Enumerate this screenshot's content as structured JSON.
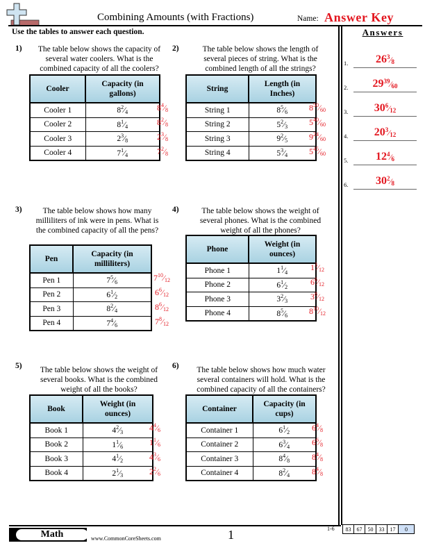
{
  "header": {
    "title": "Combining Amounts (with Fractions)",
    "name_label": "Name:",
    "name_value": "Answer Key",
    "instructions": "Use the tables to answer each question."
  },
  "answers_panel": {
    "title": "Answers",
    "items": [
      {
        "num": "1.",
        "whole": "26",
        "numer": "3",
        "denom": "8"
      },
      {
        "num": "2.",
        "whole": "29",
        "numer": "39",
        "denom": "60"
      },
      {
        "num": "3.",
        "whole": "30",
        "numer": "6",
        "denom": "12"
      },
      {
        "num": "4.",
        "whole": "20",
        "numer": "3",
        "denom": "12"
      },
      {
        "num": "5.",
        "whole": "12",
        "numer": "4",
        "denom": "6"
      },
      {
        "num": "6.",
        "whole": "30",
        "numer": "2",
        "denom": "8"
      }
    ]
  },
  "problems": [
    {
      "num": "1)",
      "text": "The table below shows the capacity of several water coolers. What is the combined capacity of all the coolers?",
      "headers": [
        "Cooler",
        "Capacity (in gallons)"
      ],
      "rows": [
        {
          "label": "Cooler 1",
          "value": {
            "w": "8",
            "n": "2",
            "d": "4"
          },
          "answer": {
            "w": "8",
            "n": "4",
            "d": "8"
          }
        },
        {
          "label": "Cooler 2",
          "value": {
            "w": "8",
            "n": "1",
            "d": "4"
          },
          "answer": {
            "w": "8",
            "n": "2",
            "d": "8"
          }
        },
        {
          "label": "Cooler 3",
          "value": {
            "w": "2",
            "n": "3",
            "d": "8"
          },
          "answer": {
            "w": "2",
            "n": "3",
            "d": "8"
          }
        },
        {
          "label": "Cooler 4",
          "value": {
            "w": "7",
            "n": "1",
            "d": "4"
          },
          "answer": {
            "w": "7",
            "n": "2",
            "d": "8"
          }
        }
      ]
    },
    {
      "num": "2)",
      "text": "The table below shows the length of several pieces of string. What is the combined length of all the strings?",
      "headers": [
        "String",
        "Length (in Inches)"
      ],
      "rows": [
        {
          "label": "String 1",
          "value": {
            "w": "8",
            "n": "5",
            "d": "6"
          },
          "answer": {
            "w": "8",
            "n": "50",
            "d": "60"
          }
        },
        {
          "label": "String 2",
          "value": {
            "w": "5",
            "n": "2",
            "d": "3"
          },
          "answer": {
            "w": "5",
            "n": "40",
            "d": "60"
          }
        },
        {
          "label": "String 3",
          "value": {
            "w": "9",
            "n": "2",
            "d": "5"
          },
          "answer": {
            "w": "9",
            "n": "24",
            "d": "60"
          }
        },
        {
          "label": "String 4",
          "value": {
            "w": "5",
            "n": "3",
            "d": "4"
          },
          "answer": {
            "w": "5",
            "n": "45",
            "d": "60"
          }
        }
      ]
    },
    {
      "num": "3)",
      "text": "The table below shows how many milliliters of ink were in pens. What is the combined capacity of all the pens?",
      "headers": [
        "Pen",
        "Capacity (in milliliters)"
      ],
      "rows": [
        {
          "label": "Pen 1",
          "value": {
            "w": "7",
            "n": "5",
            "d": "6"
          },
          "answer": {
            "w": "7",
            "n": "10",
            "d": "12"
          }
        },
        {
          "label": "Pen 2",
          "value": {
            "w": "6",
            "n": "1",
            "d": "2"
          },
          "answer": {
            "w": "6",
            "n": "6",
            "d": "12"
          }
        },
        {
          "label": "Pen 3",
          "value": {
            "w": "8",
            "n": "2",
            "d": "4"
          },
          "answer": {
            "w": "8",
            "n": "6",
            "d": "12"
          }
        },
        {
          "label": "Pen 4",
          "value": {
            "w": "7",
            "n": "4",
            "d": "6"
          },
          "answer": {
            "w": "7",
            "n": "8",
            "d": "12"
          }
        }
      ]
    },
    {
      "num": "4)",
      "text": "The table below shows the weight of several phones. What is the combined weight of all the phones?",
      "headers": [
        "Phone",
        "Weight (in ounces)"
      ],
      "rows": [
        {
          "label": "Phone 1",
          "value": {
            "w": "1",
            "n": "1",
            "d": "4"
          },
          "answer": {
            "w": "1",
            "n": "3",
            "d": "12"
          }
        },
        {
          "label": "Phone 2",
          "value": {
            "w": "6",
            "n": "1",
            "d": "2"
          },
          "answer": {
            "w": "6",
            "n": "6",
            "d": "12"
          }
        },
        {
          "label": "Phone 3",
          "value": {
            "w": "3",
            "n": "2",
            "d": "3"
          },
          "answer": {
            "w": "3",
            "n": "8",
            "d": "12"
          }
        },
        {
          "label": "Phone 4",
          "value": {
            "w": "8",
            "n": "5",
            "d": "6"
          },
          "answer": {
            "w": "8",
            "n": "10",
            "d": "12"
          }
        }
      ]
    },
    {
      "num": "5)",
      "text": "The table below shows the weight of several books. What is the combined weight of all the books?",
      "headers": [
        "Book",
        "Weight (in ounces)"
      ],
      "rows": [
        {
          "label": "Book 1",
          "value": {
            "w": "4",
            "n": "2",
            "d": "3"
          },
          "answer": {
            "w": "4",
            "n": "4",
            "d": "6"
          }
        },
        {
          "label": "Book 2",
          "value": {
            "w": "1",
            "n": "1",
            "d": "6"
          },
          "answer": {
            "w": "1",
            "n": "1",
            "d": "6"
          }
        },
        {
          "label": "Book 3",
          "value": {
            "w": "4",
            "n": "1",
            "d": "2"
          },
          "answer": {
            "w": "4",
            "n": "3",
            "d": "6"
          }
        },
        {
          "label": "Book 4",
          "value": {
            "w": "2",
            "n": "1",
            "d": "3"
          },
          "answer": {
            "w": "2",
            "n": "2",
            "d": "6"
          }
        }
      ]
    },
    {
      "num": "6)",
      "text": "The table below shows how much water several containers will hold. What is the combined capacity of all the containers?",
      "headers": [
        "Container",
        "Capacity (in cups)"
      ],
      "rows": [
        {
          "label": "Container 1",
          "value": {
            "w": "6",
            "n": "1",
            "d": "2"
          },
          "answer": {
            "w": "6",
            "n": "4",
            "d": "8"
          }
        },
        {
          "label": "Container 2",
          "value": {
            "w": "6",
            "n": "3",
            "d": "4"
          },
          "answer": {
            "w": "6",
            "n": "6",
            "d": "8"
          }
        },
        {
          "label": "Container 3",
          "value": {
            "w": "8",
            "n": "4",
            "d": "8"
          },
          "answer": {
            "w": "8",
            "n": "4",
            "d": "8"
          }
        },
        {
          "label": "Container 4",
          "value": {
            "w": "8",
            "n": "2",
            "d": "4"
          },
          "answer": {
            "w": "8",
            "n": "4",
            "d": "8"
          }
        }
      ]
    }
  ],
  "footer": {
    "subject": "Math",
    "site": "www.CommonCoreSheets.com",
    "page": "1",
    "score_label": "1-6",
    "scores": [
      "83",
      "67",
      "50",
      "33",
      "17",
      "0"
    ]
  },
  "colors": {
    "answer_red": "#e3161f",
    "header_blue": "#a9d2e2",
    "score_highlight": "#cfe0f7"
  }
}
